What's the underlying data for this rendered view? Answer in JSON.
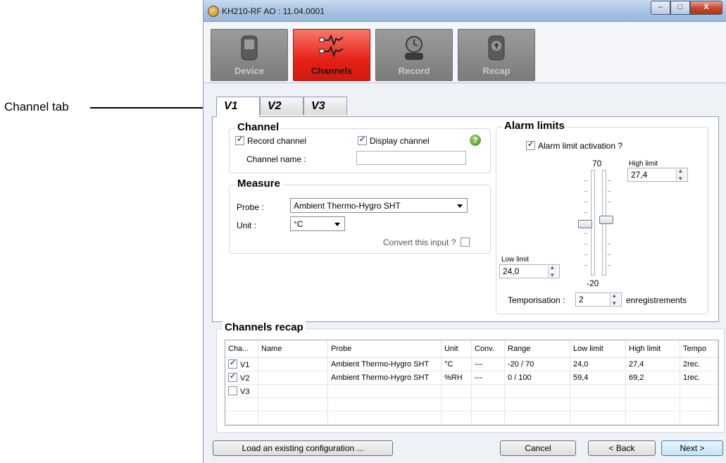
{
  "annotation": {
    "label": "Channel tab"
  },
  "window": {
    "title": "KH210-RF AO : 11.04.0001",
    "minimize": "–",
    "maximize": "□",
    "close": "X"
  },
  "toolbar": {
    "buttons": [
      {
        "label": "Device",
        "icon": "device-icon"
      },
      {
        "label": "Channels",
        "icon": "channels-icon",
        "active": true
      },
      {
        "label": "Record",
        "icon": "record-icon"
      },
      {
        "label": "Recap",
        "icon": "recap-icon"
      }
    ]
  },
  "tabs": [
    "V1",
    "V2",
    "V3"
  ],
  "channel": {
    "title": "Channel",
    "record_label": "Record channel",
    "record_checked": true,
    "display_label": "Display channel",
    "display_checked": true,
    "name_label": "Channel name :",
    "name_value": ""
  },
  "measure": {
    "title": "Measure",
    "probe_label": "Probe :",
    "probe_value": "Ambient Thermo-Hygro SHT",
    "unit_label": "Unit :",
    "unit_value": "°C",
    "convert_label": "Convert this input ?",
    "convert_checked": false
  },
  "alarm": {
    "title": "Alarm limits",
    "activation_label": "Alarm limit activation ?",
    "activation_checked": true,
    "scale_max": "70",
    "scale_min": "-20",
    "high_label": "High limit",
    "high_value": "27,4",
    "low_label": "Low limit",
    "low_value": "24,0",
    "temporisation_label": "Temporisation :",
    "temporisation_value": "2",
    "temporisation_unit": "enregistrements"
  },
  "recap": {
    "title": "Channels recap",
    "columns": [
      "Cha...",
      "Name",
      "Probe",
      "Unit",
      "Conv.",
      "Range",
      "Low limit",
      "High limit",
      "Tempo"
    ],
    "rows": [
      {
        "checked": true,
        "channel": "V1",
        "name": "",
        "probe": "Ambient Thermo-Hygro SHT",
        "unit": "°C",
        "conv": "---",
        "range": "-20 / 70",
        "low": "24,0",
        "high": "27,4",
        "tempo": "2rec."
      },
      {
        "checked": true,
        "channel": "V2",
        "name": "",
        "probe": "Ambient Thermo-Hygro SHT",
        "unit": "%RH",
        "conv": "---",
        "range": "0 / 100",
        "low": "59,4",
        "high": "69,2",
        "tempo": "1rec."
      },
      {
        "checked": false,
        "channel": "V3",
        "name": "",
        "probe": "",
        "unit": "",
        "conv": "",
        "range": "",
        "low": "",
        "high": "",
        "tempo": ""
      }
    ]
  },
  "footer": {
    "load_label": "Load an existing configuration ...",
    "cancel_label": "Cancel",
    "back_label": "< Back",
    "next_label": "Next >"
  }
}
